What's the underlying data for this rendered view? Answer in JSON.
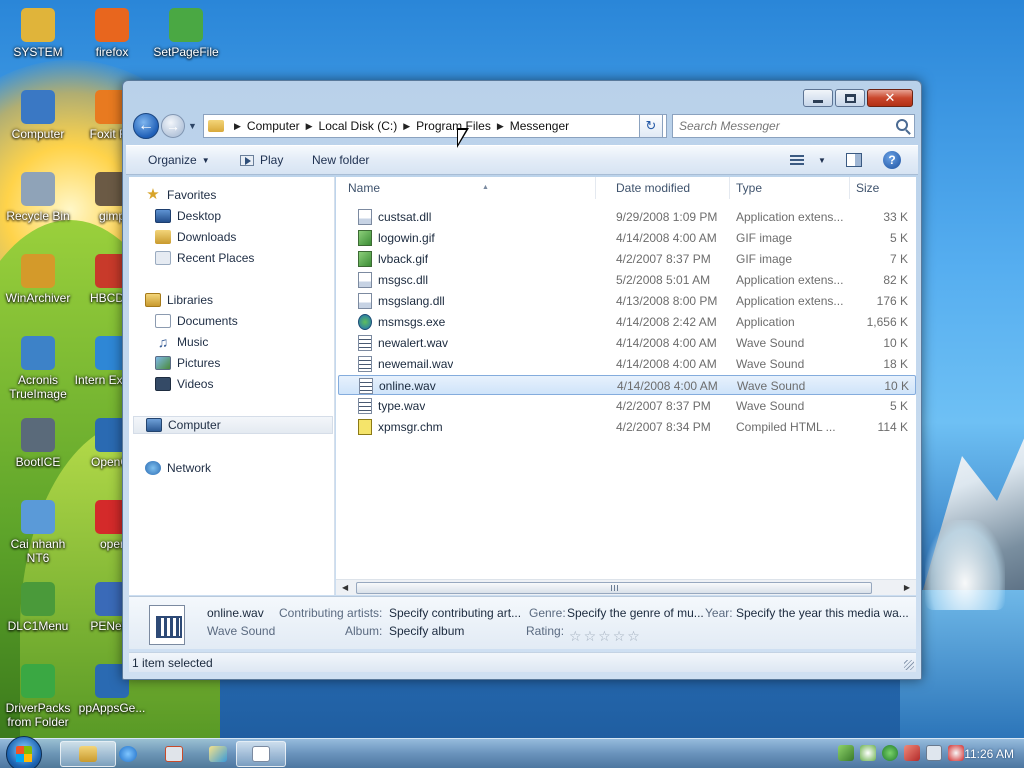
{
  "desktop": {
    "icons": [
      {
        "label": "SYSTEM",
        "icon": "folder-user-icon",
        "color": "#e0b43a"
      },
      {
        "label": "firefox",
        "icon": "firefox-icon",
        "color": "#e8661e"
      },
      {
        "label": "SetPageFile",
        "icon": "setpagefile-icon",
        "color": "#4aa843"
      },
      {
        "label": "Computer",
        "icon": "computer-icon",
        "color": "#3a78c4"
      },
      {
        "label": "Foxit Re",
        "icon": "pdf-icon",
        "color": "#e87a20"
      },
      {
        "label": "Recycle Bin",
        "icon": "recycle-bin-icon",
        "color": "#8fa3b8"
      },
      {
        "label": "gimp",
        "icon": "gimp-icon",
        "color": "#6b5a45"
      },
      {
        "label": "WinArchiver",
        "icon": "archive-icon",
        "color": "#d49a2a"
      },
      {
        "label": "HBCDM",
        "icon": "tools-icon",
        "color": "#c83a2a"
      },
      {
        "label": "Acronis TrueImage",
        "icon": "acronis-icon",
        "color": "#3d82c8"
      },
      {
        "label": "Intern Explore",
        "icon": "ie-icon",
        "color": "#2e87d6"
      },
      {
        "label": "BootICE",
        "icon": "bootice-icon",
        "color": "#5a6a7a"
      },
      {
        "label": "OpenOf",
        "icon": "openoffice-icon",
        "color": "#2a6ab2"
      },
      {
        "label": "Cai nhanh NT6",
        "icon": "install-icon",
        "color": "#5a9ad8"
      },
      {
        "label": "oper",
        "icon": "opera-icon",
        "color": "#d42a2a"
      },
      {
        "label": "DLC1Menu",
        "icon": "dlc-icon",
        "color": "#4a9a3a"
      },
      {
        "label": "PENetw",
        "icon": "network-icon",
        "color": "#3a6ab8"
      },
      {
        "label": "DriverPacks from Folder",
        "icon": "driverpacks-icon",
        "color": "#3aa843"
      },
      {
        "label": "ppAppsGe...",
        "icon": "apps-icon",
        "color": "#2a6ab2"
      }
    ]
  },
  "window": {
    "controls": {
      "minimize": "minimize",
      "maximize": "maximize",
      "close": "✕"
    },
    "address": {
      "crumbs": [
        "Computer",
        "Local Disk (C:)",
        "Program Files",
        "Messenger"
      ]
    },
    "search": {
      "placeholder": "Search Messenger"
    },
    "toolbar": {
      "organize": "Organize",
      "play": "Play",
      "new_folder": "New folder"
    },
    "nav_pane": {
      "favorites": "Favorites",
      "desktop": "Desktop",
      "downloads": "Downloads",
      "recent_places": "Recent Places",
      "libraries": "Libraries",
      "documents": "Documents",
      "music": "Music",
      "pictures": "Pictures",
      "videos": "Videos",
      "computer": "Computer",
      "network": "Network"
    },
    "columns": {
      "name": "Name",
      "date": "Date modified",
      "type": "Type",
      "size": "Size"
    },
    "files": [
      {
        "name": "custsat.dll",
        "date": "9/29/2008 1:09 PM",
        "type": "Application extens...",
        "size": "33 K",
        "kind": "dll"
      },
      {
        "name": "logowin.gif",
        "date": "4/14/2008 4:00 AM",
        "type": "GIF image",
        "size": "5 K",
        "kind": "gif"
      },
      {
        "name": "lvback.gif",
        "date": "4/2/2007 8:37 PM",
        "type": "GIF image",
        "size": "7 K",
        "kind": "gif"
      },
      {
        "name": "msgsc.dll",
        "date": "5/2/2008 5:01 AM",
        "type": "Application extens...",
        "size": "82 K",
        "kind": "dll"
      },
      {
        "name": "msgslang.dll",
        "date": "4/13/2008 8:00 PM",
        "type": "Application extens...",
        "size": "176 K",
        "kind": "dll"
      },
      {
        "name": "msmsgs.exe",
        "date": "4/14/2008 2:42 AM",
        "type": "Application",
        "size": "1,656 K",
        "kind": "exe"
      },
      {
        "name": "newalert.wav",
        "date": "4/14/2008 4:00 AM",
        "type": "Wave Sound",
        "size": "10 K",
        "kind": "wav"
      },
      {
        "name": "newemail.wav",
        "date": "4/14/2008 4:00 AM",
        "type": "Wave Sound",
        "size": "18 K",
        "kind": "wav"
      },
      {
        "name": "online.wav",
        "date": "4/14/2008 4:00 AM",
        "type": "Wave Sound",
        "size": "10 K",
        "kind": "wav",
        "selected": true
      },
      {
        "name": "type.wav",
        "date": "4/2/2007 8:37 PM",
        "type": "Wave Sound",
        "size": "5 K",
        "kind": "wav"
      },
      {
        "name": "xpmsgr.chm",
        "date": "4/2/2007 8:34 PM",
        "type": "Compiled HTML ...",
        "size": "114 K",
        "kind": "chm"
      }
    ],
    "details": {
      "filename": "online.wav",
      "filetype": "Wave Sound",
      "artists_label": "Contributing artists:",
      "artists_value": "Specify contributing art...",
      "album_label": "Album:",
      "album_value": "Specify album",
      "genre_label": "Genre:",
      "genre_value": "Specify the genre of mu...",
      "rating_label": "Rating:",
      "year_label": "Year:",
      "year_value": "Specify the year this media wa...",
      "rating": 0
    },
    "status": {
      "text": "1 item selected"
    }
  },
  "taskbar": {
    "clock": "11:26 AM",
    "colors": {
      "accent": "#1d66b5"
    }
  }
}
